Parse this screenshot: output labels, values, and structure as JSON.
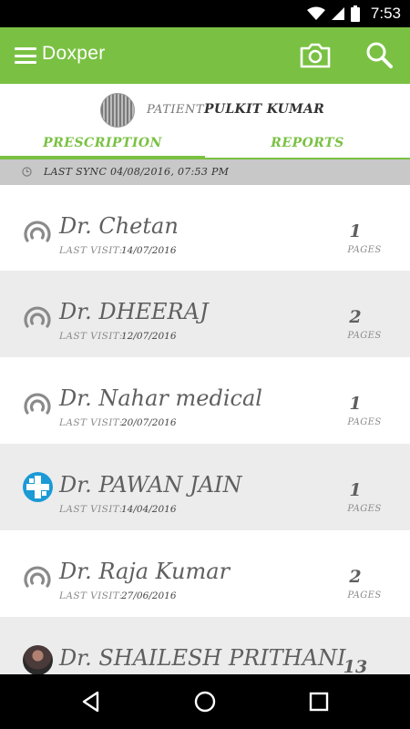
{
  "status_bar": {
    "time": "7:53",
    "icons": [
      "signal-icon",
      "wifi-icon",
      "cellular-icon",
      "battery-icon"
    ]
  },
  "app_bar": {
    "title": "Doxper",
    "background_color": "#7ac143",
    "icons": [
      "menu-icon",
      "camera-icon",
      "search-icon"
    ]
  },
  "patient": {
    "label": "PATIENT",
    "name": "PULKIT KUMAR"
  },
  "tabs": [
    {
      "label": "PRESCRIPTION",
      "selected": true
    },
    {
      "label": "REPORTS",
      "selected": false
    }
  ],
  "sync": {
    "text": "LAST SYNC 04/08/2016, 07:53 PM"
  },
  "doctors": [
    {
      "name": "Dr. Chetan",
      "visit_label": "LAST VISIT:",
      "visit_date": "14/07/2016",
      "pages": "1",
      "pages_label": "PAGES",
      "icon": "doctor-placeholder-icon"
    },
    {
      "name": "Dr. DHEERAJ",
      "visit_label": "LAST VISIT:",
      "visit_date": "12/07/2016",
      "pages": "2",
      "pages_label": "PAGES",
      "icon": "doctor-placeholder-icon"
    },
    {
      "name": "Dr. Nahar medical",
      "visit_label": "LAST VISIT:",
      "visit_date": "20/07/2016",
      "pages": "1",
      "pages_label": "PAGES",
      "icon": "doctor-placeholder-icon"
    },
    {
      "name": "Dr. PAWAN JAIN",
      "visit_label": "LAST VISIT:",
      "visit_date": "14/04/2016",
      "pages": "1",
      "pages_label": "PAGES",
      "icon": "clinic-logo-avatar"
    },
    {
      "name": "Dr. Raja Kumar",
      "visit_label": "LAST VISIT:",
      "visit_date": "27/06/2016",
      "pages": "2",
      "pages_label": "PAGES",
      "icon": "doctor-placeholder-icon"
    },
    {
      "name": "Dr. SHAILESH PRITHANI",
      "visit_label": "",
      "visit_date": "",
      "pages": "13",
      "pages_label": "",
      "icon": "doctor-photo-avatar"
    }
  ],
  "nav_bar": {
    "icons": [
      "back-icon",
      "home-icon",
      "recents-icon"
    ]
  }
}
